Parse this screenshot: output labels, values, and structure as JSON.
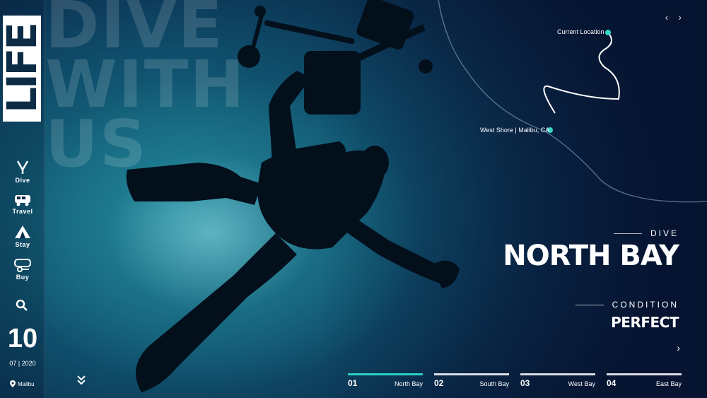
{
  "brand": {
    "logo_text": "LIFE"
  },
  "headline": {
    "lines": [
      "DIVE",
      "WITH",
      "US"
    ]
  },
  "sidebar": {
    "items": [
      {
        "label": "Dive",
        "icon": "dive-icon"
      },
      {
        "label": "Travel",
        "icon": "van-icon"
      },
      {
        "label": "Stay",
        "icon": "tent-icon"
      },
      {
        "label": "Buy",
        "icon": "mask-icon"
      }
    ],
    "search_icon": "search-icon"
  },
  "date": {
    "day": "10",
    "month_year": "07 | 2020"
  },
  "location": {
    "label": "Malibu"
  },
  "map": {
    "current_location": "Current Location",
    "start_location": "West Shore | Malibu, CA"
  },
  "info": {
    "dive_label": "DIVE",
    "dive_site": "NORTH BAY",
    "condition_label": "CONDITION",
    "condition_value": "PERFECT"
  },
  "tabs": [
    {
      "num": "01",
      "name": "North Bay",
      "active": true
    },
    {
      "num": "02",
      "name": "South Bay",
      "active": false
    },
    {
      "num": "03",
      "name": "West Bay",
      "active": false
    },
    {
      "num": "04",
      "name": "East Bay",
      "active": false
    }
  ],
  "colors": {
    "accent": "#2bd1c1",
    "deep": "#071935"
  }
}
